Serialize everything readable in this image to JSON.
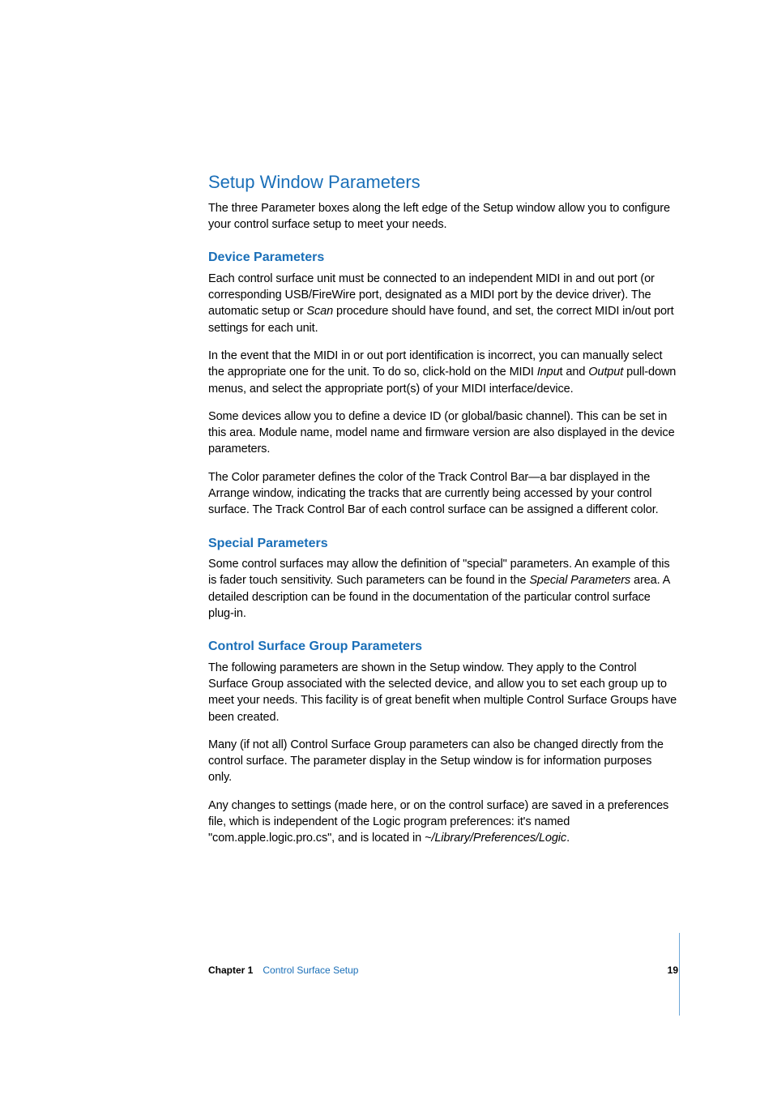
{
  "content": {
    "h1": "Setup Window Parameters",
    "intro": "The three Parameter boxes along the left edge of the Setup window allow you to configure your control surface setup to meet your needs.",
    "device": {
      "heading": "Device Parameters",
      "p1_a": "Each control surface unit must be connected to an independent MIDI in and out port (or corresponding USB/FireWire port, designated as a MIDI port by the device driver). The automatic setup or ",
      "p1_scan": "Scan",
      "p1_b": " procedure should have found, and set, the correct MIDI in/out port settings for each unit.",
      "p2_a": "In the event that the MIDI in or out port identification is incorrect, you can manually select the appropriate one for the unit. To do so, click-hold on the MIDI ",
      "p2_input": "Inpu",
      "p2_b": "t and ",
      "p2_output": "Output",
      "p2_c": " pull-down menus, and select the appropriate port(s) of your MIDI interface/device.",
      "p3": "Some devices allow you to define a device ID (or global/basic channel). This can be set in this area. Module name, model name and firmware version are also displayed in the device parameters.",
      "p4": "The Color parameter defines the color of the Track Control Bar—a bar displayed in the Arrange window, indicating the tracks that are currently being accessed by your control surface. The Track Control Bar of each control surface can be assigned a different color."
    },
    "special": {
      "heading": "Special Parameters",
      "p1_a": "Some control surfaces may allow the definition of \"special\" parameters. An example of this is fader touch sensitivity. Such parameters can be found in the ",
      "p1_sp": "Special Parameters",
      "p1_b": " area. A detailed description can be found in the documentation of the particular control surface plug-in."
    },
    "csg": {
      "heading": "Control Surface Group Parameters",
      "p1": "The following parameters are shown in the Setup window. They apply to the Control Surface Group associated with the selected device, and allow you to set each group up to meet your needs. This facility is of great benefit when multiple Control Surface Groups have been created.",
      "p2": "Many (if not all) Control Surface Group parameters can also be changed directly from the control surface. The parameter display in the Setup window is for information purposes only.",
      "p3_a": "Any changes to settings (made here, or on the control surface) are saved in a preferences file, which is independent of the Logic program preferences:  it's named \"com.apple.logic.pro.cs\", and is located in ",
      "p3_path": "~/Library/Preferences/Logic",
      "p3_b": "."
    }
  },
  "footer": {
    "chapter_label": "Chapter 1",
    "chapter_name": "Control Surface Setup",
    "page": "19"
  }
}
